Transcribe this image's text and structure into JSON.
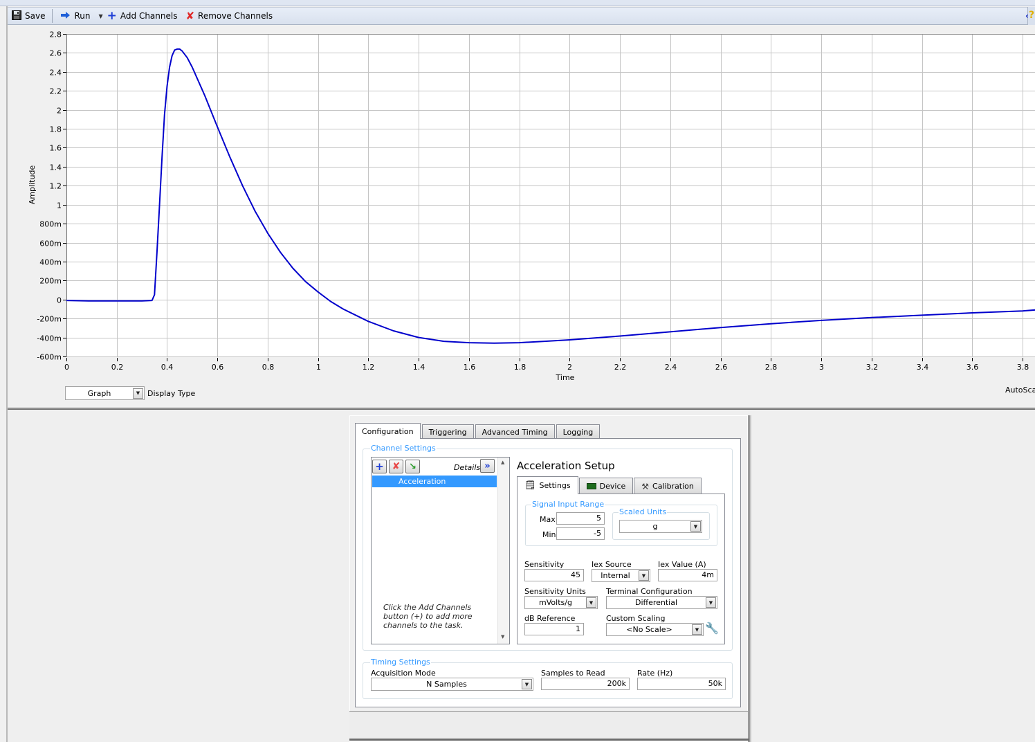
{
  "toolbar": {
    "save_label": "Save",
    "run_label": "Run",
    "add_channels_label": "Add Channels",
    "remove_channels_label": "Remove Channels"
  },
  "graph": {
    "display_type_value": "Graph",
    "display_type_label": "Display Type",
    "autoscale_label": "AutoScal"
  },
  "chart_data": {
    "type": "line",
    "title": "",
    "xlabel": "Time",
    "ylabel": "Amplitude",
    "xlim": [
      0,
      3.85
    ],
    "ylim": [
      -0.6,
      2.8
    ],
    "grid": true,
    "x_ticks": [
      0,
      0.2,
      0.4,
      0.6,
      0.8,
      1,
      1.2,
      1.4,
      1.6,
      1.8,
      2,
      2.2,
      2.4,
      2.6,
      2.8,
      3,
      3.2,
      3.4,
      3.6,
      3.8
    ],
    "x_tick_labels": [
      "0",
      "0.2",
      "0.4",
      "0.6",
      "0.8",
      "1",
      "1.2",
      "1.4",
      "1.6",
      "1.8",
      "2",
      "2.2",
      "2.4",
      "2.6",
      "2.8",
      "3",
      "3.2",
      "3.4",
      "3.6",
      "3.8"
    ],
    "y_ticks": [
      2.8,
      2.6,
      2.4,
      2.2,
      2,
      1.8,
      1.6,
      1.4,
      1.2,
      1,
      0.8,
      0.6,
      0.4,
      0.2,
      0,
      -0.2,
      -0.4,
      -0.6
    ],
    "y_tick_labels": [
      "2.8",
      "2.6",
      "2.4",
      "2.2",
      "2",
      "1.8",
      "1.6",
      "1.4",
      "1.2",
      "1",
      "800m",
      "600m",
      "400m",
      "200m",
      "0",
      "-200m",
      "-400m",
      "-600m"
    ],
    "series": [
      {
        "name": "Acceleration",
        "color": "#0000cc",
        "x": [
          0,
          0.1,
          0.2,
          0.3,
          0.34,
          0.35,
          0.36,
          0.37,
          0.38,
          0.39,
          0.4,
          0.41,
          0.42,
          0.43,
          0.44,
          0.45,
          0.46,
          0.48,
          0.5,
          0.55,
          0.6,
          0.65,
          0.7,
          0.75,
          0.8,
          0.85,
          0.9,
          0.95,
          1.0,
          1.05,
          1.1,
          1.2,
          1.3,
          1.4,
          1.5,
          1.6,
          1.7,
          1.8,
          1.9,
          2.0,
          2.2,
          2.4,
          2.6,
          2.8,
          3.0,
          3.2,
          3.4,
          3.6,
          3.8,
          3.85
        ],
        "y": [
          -0.01,
          -0.015,
          -0.015,
          -0.015,
          -0.01,
          0.05,
          0.5,
          1.0,
          1.5,
          1.95,
          2.25,
          2.45,
          2.57,
          2.63,
          2.64,
          2.64,
          2.62,
          2.55,
          2.45,
          2.15,
          1.82,
          1.5,
          1.2,
          0.93,
          0.7,
          0.5,
          0.33,
          0.19,
          0.08,
          -0.02,
          -0.1,
          -0.23,
          -0.33,
          -0.4,
          -0.44,
          -0.455,
          -0.46,
          -0.455,
          -0.44,
          -0.425,
          -0.385,
          -0.34,
          -0.295,
          -0.255,
          -0.22,
          -0.19,
          -0.165,
          -0.14,
          -0.12,
          -0.11
        ]
      }
    ]
  },
  "config": {
    "tabs": [
      "Configuration",
      "Triggering",
      "Advanced Timing",
      "Logging"
    ],
    "active_tab": "Configuration",
    "channel_settings": {
      "title": "Channel Settings",
      "details_label": "Details",
      "channels": [
        "Acceleration"
      ],
      "hint": "Click the Add Channels button (+) to add more channels to the task."
    },
    "setup": {
      "title": "Acceleration Setup",
      "subtabs": [
        "Settings",
        "Device",
        "Calibration"
      ],
      "active_subtab": "Settings",
      "signal_input_range": {
        "title": "Signal Input Range",
        "max_label": "Max",
        "max_value": "5",
        "min_label": "Min",
        "min_value": "-5"
      },
      "scaled_units": {
        "title": "Scaled Units",
        "value": "g"
      },
      "sensitivity_label": "Sensitivity",
      "sensitivity_value": "45",
      "iex_source_label": "Iex Source",
      "iex_source_value": "Internal",
      "iex_value_label": "Iex Value (A)",
      "iex_value_value": "4m",
      "sensitivity_units_label": "Sensitivity Units",
      "sensitivity_units_value": "mVolts/g",
      "terminal_config_label": "Terminal Configuration",
      "terminal_config_value": "Differential",
      "db_reference_label": "dB Reference",
      "db_reference_value": "1",
      "custom_scaling_label": "Custom Scaling",
      "custom_scaling_value": "<No Scale>"
    },
    "timing": {
      "title": "Timing Settings",
      "acq_mode_label": "Acquisition Mode",
      "acq_mode_value": "N Samples",
      "samples_label": "Samples to Read",
      "samples_value": "200k",
      "rate_label": "Rate (Hz)",
      "rate_value": "50k"
    }
  }
}
